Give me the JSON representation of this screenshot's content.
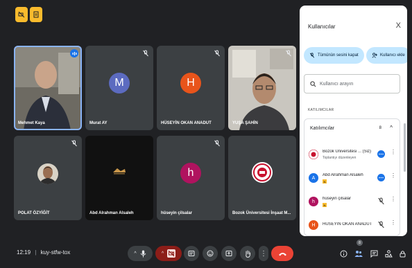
{
  "top_buttons": [
    {
      "icon": "no-video-icon"
    },
    {
      "icon": "document-icon"
    }
  ],
  "tiles": [
    {
      "name": "Mehmet Kaya",
      "type": "photo",
      "speaking": true
    },
    {
      "name": "Murat AY",
      "type": "avatar",
      "letter": "M",
      "color": "#5c6bc0",
      "muted": true
    },
    {
      "name": "HÜSEYİN OKAN ANADUT",
      "type": "avatar",
      "letter": "H",
      "color": "#e8541b",
      "muted": true
    },
    {
      "name": "YUŞA ŞAHİN",
      "type": "photo",
      "muted": true
    },
    {
      "name": "POLAT ÖZYİĞİT",
      "type": "photo",
      "muted": true
    },
    {
      "name": "Abd Alrahman Alsaleh",
      "type": "dark"
    },
    {
      "name": "hüseyin çilsalar",
      "type": "avatar",
      "letter": "h",
      "color": "#b0135f",
      "muted": true
    },
    {
      "name": "Bozok Üniversitesi İnşaat M...",
      "type": "logo"
    }
  ],
  "panel": {
    "title": "Kullanıcılar",
    "close": "X",
    "mute_all": "Tümünün sesini kapat",
    "add_user": "Kullanıcı ekle",
    "search_placeholder": "Kullanıcı arayın",
    "section": "KATILIMCILAR",
    "group_title": "Katılımcılar",
    "group_count": "8",
    "participants": [
      {
        "name": "Bozok Üniversitesi ... (Siz)",
        "sub": "Toplantıyı düzenleyen",
        "type": "logo",
        "action": "more-dots"
      },
      {
        "name": "Abd Alrahman Alsaleh",
        "letter": "A",
        "color": "#1a73e8",
        "badge": true,
        "action": "more-dots"
      },
      {
        "name": "hüseyin çilsalar",
        "letter": "h",
        "color": "#b0135f",
        "badge": true,
        "action": "mic-off"
      },
      {
        "name": "HÜSEYİN OKAN ANADUT",
        "letter": "H",
        "color": "#e8541b",
        "action": "mic-off"
      }
    ]
  },
  "bottom": {
    "time": "12:19",
    "separator": "|",
    "code": "kuy-stfw-tox",
    "people_count": "8"
  }
}
